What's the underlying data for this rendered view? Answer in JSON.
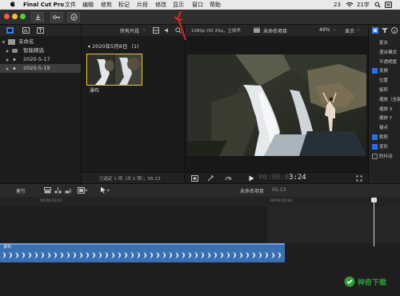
{
  "menubar": {
    "app_name": "Final Cut Pro",
    "items": [
      "文件",
      "编辑",
      "修剪",
      "标记",
      "片段",
      "修改",
      "显示",
      "窗口",
      "帮助"
    ],
    "right_num": "23",
    "right_date": "21宇"
  },
  "library": {
    "name": "未命名",
    "items": [
      {
        "label": "智能精选",
        "type": "folder"
      },
      {
        "label": "2020-5-17",
        "type": "event"
      },
      {
        "label": "2020-5-19",
        "type": "event",
        "selected": true
      }
    ]
  },
  "browser": {
    "filter": "所有片段",
    "date_header": "2020年5月8日",
    "count": "(1)",
    "clip_name": "瀑布",
    "status": "已选定 1 项（共 1 项），05:13"
  },
  "viewer": {
    "format": "1080p HD 25p，立体声",
    "project_name": "未命名项目",
    "zoom": "49%",
    "show_label": "显示",
    "timecode": "3:24"
  },
  "inspector": {
    "items": [
      {
        "label": "复合",
        "check": null
      },
      {
        "label": "混合模式",
        "check": null
      },
      {
        "label": "不透明度",
        "check": null
      },
      {
        "label": "变换",
        "check": true
      },
      {
        "label": "位置",
        "check": null
      },
      {
        "label": "旋转",
        "check": null
      },
      {
        "label": "缩放（全部）",
        "check": null
      },
      {
        "label": "缩放 X",
        "check": null
      },
      {
        "label": "缩放 Y",
        "check": null
      },
      {
        "label": "锚点",
        "check": null
      },
      {
        "label": "裁剪",
        "check": true
      },
      {
        "label": "变形",
        "check": true
      },
      {
        "label": "防抖动",
        "check": false
      }
    ]
  },
  "timeline": {
    "index_label": "索引",
    "project": "未命名项目",
    "duration": "05:13",
    "ticks": [
      "00:00:03:23",
      "00:00:03:24"
    ],
    "clip_label": "瀑布"
  },
  "watermark": {
    "text": "神奇下载"
  },
  "colors": {
    "accent": "#2f6fe4",
    "clip": "#3a6fb2",
    "arrow": "#e0281f"
  }
}
